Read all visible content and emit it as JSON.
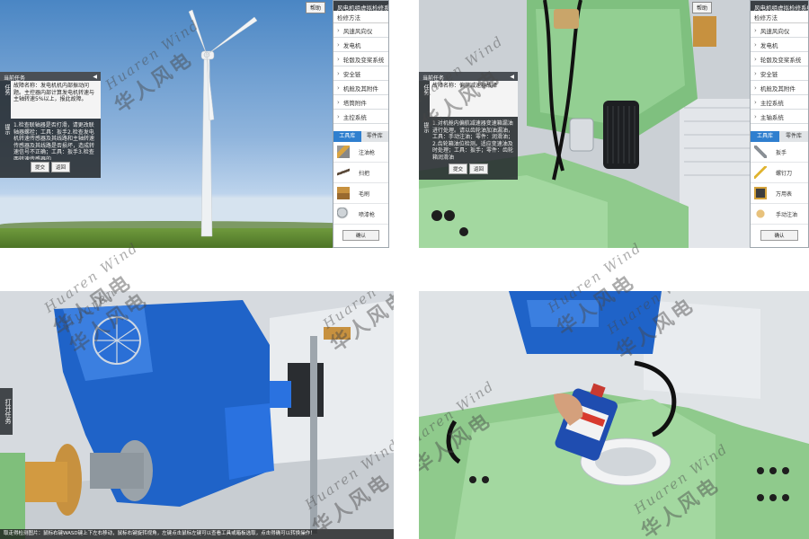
{
  "q1": {
    "help_button": "帮助",
    "title": "风电机组虚拟检修系统",
    "task_panel": {
      "header": "当前任务",
      "task_tab": "任务",
      "hint_tab": "提示",
      "description": "故障名称：发电机机内部振动问题。主控器内部计算发电机转速与主轴转速5%以上，报此故障。",
      "hint": "1.检查联轴器是否打滑，请更改联轴器螺栓；工具：扳手2.检查发电机转速传感器及其线路和主轴转速传感器及其线路是否损坏，造成转速信号不正确；工具：扳手3.检查两转速传感器的...",
      "submit": "提交",
      "back": "返回"
    },
    "menu_header": "检修方法",
    "menu": [
      "风速风向仪",
      "发电机",
      "轮毂及变桨系统",
      "安全链",
      "机舱及其附件",
      "塔筒附件",
      "主控系统"
    ],
    "tab_tools": "工具库",
    "tab_parts": "零件库",
    "tools": [
      "注油枪",
      "扫把",
      "毛刷",
      "喷漆枪"
    ],
    "confirm": "确认"
  },
  "q2": {
    "help_button": "帮助",
    "title": "风电机组虚拟检修系统",
    "task_panel": {
      "header": "当前任务",
      "task_tab": "任务",
      "hint_tab": "提示",
      "description": "故障名称：偏航减速器故障",
      "hint": "1.对机舱内偏航减速器变速箱漏油进行处理。请以齿轮油加油漏油，工具：手动注油；零件：润滑油；2.齿轮箱油位检测。适应变速油及时处理；工具：扳手；零件：齿轮箱润滑油",
      "submit": "提交",
      "back": "返回"
    },
    "menu_header": "检修方法",
    "menu": [
      "风速风向仪",
      "发电机",
      "轮毂及变桨系统",
      "安全链",
      "机舱及其附件",
      "主控系统",
      "主轴系统"
    ],
    "tab_tools": "工具库",
    "tab_parts": "零件库",
    "tools": [
      "扳手",
      "螺钉刀",
      "万用表",
      "手动注油"
    ],
    "confirm": "确认"
  },
  "q3": {
    "side_tab": "打开任务",
    "bottom_hint": "取走得检测图片：鼠标右键WASD键上下左右移动，鼠标右键旋转视角，左键点击鼠标左键可以查看工具或箱板选取，点击得确可以转换操作！"
  },
  "watermark": {
    "en": "Huaren Wind",
    "cn": "华人风电"
  },
  "colors": {
    "ui_blue": "#2f7fcf",
    "machine_blue": "#1f63c8",
    "machine_green": "#8fcc96",
    "panel_dark": "#3a3f44"
  }
}
